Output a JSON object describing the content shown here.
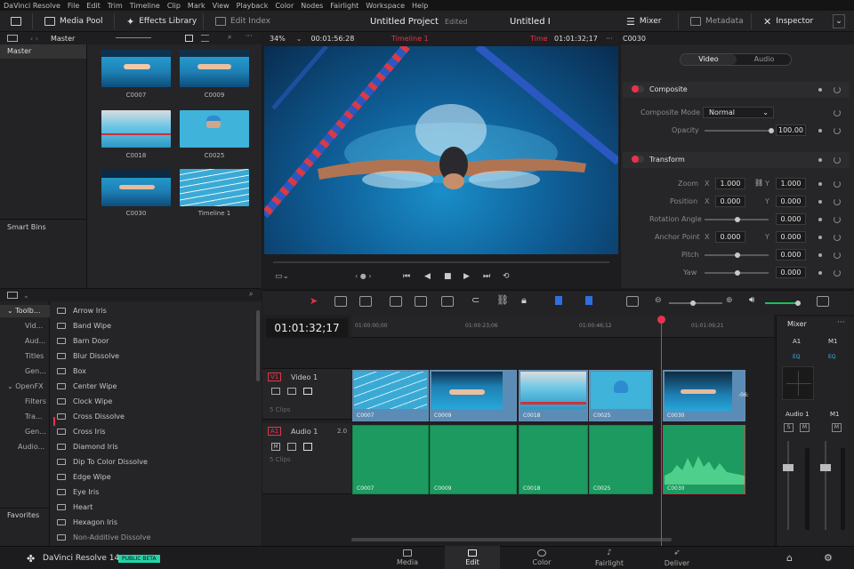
{
  "menu": {
    "app_name": "DaVinci Resolve",
    "items": [
      "File",
      "Edit",
      "Trim",
      "Timeline",
      "Clip",
      "Mark",
      "View",
      "Playback",
      "Color",
      "Nodes",
      "Fairlight",
      "Workspace",
      "Help"
    ]
  },
  "topbar": {
    "media_pool": "Media Pool",
    "effects_library": "Effects Library",
    "edit_index": "Edit Index",
    "project_title": "Untitled Project",
    "edited": "Edited",
    "timeline_title": "Untitled I",
    "mixer": "Mixer",
    "metadata": "Metadata",
    "inspector": "Inspector"
  },
  "pool": {
    "bin_label": "Master",
    "master": "Master",
    "smart_bins": "Smart Bins",
    "clips": [
      "C0007",
      "C0009",
      "C0018",
      "C0025",
      "C0030",
      "Timeline 1"
    ]
  },
  "viewer": {
    "zoom": "34%",
    "source_tc": "00:01:56:28",
    "timeline_name": "Timeline 1",
    "time_label": "Time",
    "timecode": "01:01:32;17",
    "clip_name": "C0030"
  },
  "inspector": {
    "tabs": [
      "Video",
      "Audio"
    ],
    "composite": {
      "title": "Composite",
      "mode_label": "Composite Mode",
      "mode_value": "Normal",
      "opacity_label": "Opacity",
      "opacity_value": "100.00"
    },
    "transform": {
      "title": "Transform",
      "zoom_label": "Zoom",
      "zoom_x": "1.000",
      "zoom_y": "1.000",
      "position_label": "Position",
      "pos_x": "0.000",
      "pos_y": "0.000",
      "rotation_label": "Rotation Angle",
      "rotation_value": "0.000",
      "anchor_label": "Anchor Point",
      "anchor_x": "0.000",
      "anchor_y": "0.000",
      "pitch_label": "Pitch",
      "pitch_value": "0.000",
      "yaw_label": "Yaw",
      "yaw_value": "0.000",
      "x": "X",
      "y": "Y"
    }
  },
  "effects": {
    "tree": [
      "Toolb...",
      "Vid...",
      "Aud...",
      "Titles",
      "Gen...",
      "OpenFX",
      "Filters",
      "Tra...",
      "Gen...",
      "Audio..."
    ],
    "favorites": "Favorites",
    "items": [
      "Arrow Iris",
      "Band Wipe",
      "Barn Door",
      "Blur Dissolve",
      "Box",
      "Center Wipe",
      "Clock Wipe",
      "Cross Dissolve",
      "Cross Iris",
      "Diamond Iris",
      "Dip To Color Dissolve",
      "Edge Wipe",
      "Eye Iris",
      "Heart",
      "Hexagon Iris",
      "Non-Additive Dissolve"
    ]
  },
  "timeline": {
    "timecode": "01:01:32;17",
    "ruler": [
      "01:00:00;00",
      "01:00:23;06",
      "01:00:46;12",
      "01:01:09;21"
    ],
    "video_track": {
      "tag": "V1",
      "name": "Video 1",
      "clips_count": "5 Clips"
    },
    "audio_track": {
      "tag": "A1",
      "name": "Audio 1",
      "level": "2.0",
      "clips_count": "5 Clips"
    },
    "clips": [
      "C0007",
      "C0009",
      "C0018",
      "C0025",
      "C0030"
    ],
    "trim_label": "-06:"
  },
  "mixer": {
    "title": "Mixer",
    "ch_a1": "A1",
    "ch_m1": "M1",
    "eq": "EQ",
    "audio1": "Audio 1",
    "s": "S",
    "m": "M"
  },
  "footer": {
    "app": "DaVinci Resolve 14",
    "beta": "PUBLIC BETA",
    "pages": [
      "Media",
      "Edit",
      "Color",
      "Fairlight",
      "Deliver"
    ]
  },
  "colors": {
    "accent_red": "#e8334a",
    "accent_blue": "#4a8fd6",
    "video_clip": "#5b8cb6",
    "audio_clip": "#1c9a5f"
  }
}
